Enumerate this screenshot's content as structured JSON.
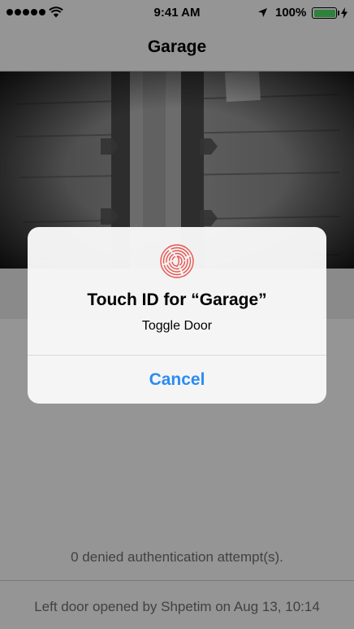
{
  "status_bar": {
    "time": "9:41 AM",
    "battery_percent": "100%",
    "signal_icon": "signal-dots-icon",
    "wifi_icon": "wifi-icon",
    "location_icon": "location-arrow-icon",
    "battery_icon": "battery-icon",
    "charging_icon": "charging-bolt-icon"
  },
  "nav": {
    "title": "Garage"
  },
  "camera": {
    "icon": "garage-camera-feed"
  },
  "main": {
    "denied_attempts": "0 denied authentication attempt(s).",
    "last_event": "Left door opened by Shpetim on Aug 13, 10:14"
  },
  "alert": {
    "icon": "fingerprint-icon",
    "title": "Touch ID for “Garage”",
    "message": "Toggle Door",
    "cancel_label": "Cancel"
  },
  "colors": {
    "accent": "#2b8cf0",
    "battery_green": "#4cd964",
    "secondary_text": "#6d6d72",
    "fingerprint_red": "#e8544f"
  }
}
